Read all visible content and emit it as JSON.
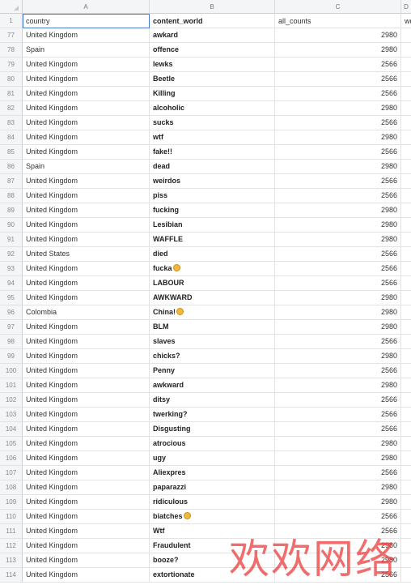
{
  "columns": [
    "A",
    "B",
    "C",
    "D"
  ],
  "header_row": {
    "num": "1",
    "country": "country",
    "content_world": "content_world",
    "all_counts": "all_counts",
    "d": "wo"
  },
  "rows": [
    {
      "num": "77",
      "country": "United Kingdom",
      "word": "awkard",
      "count": "2980"
    },
    {
      "num": "78",
      "country": "Spain",
      "word": "offence",
      "count": "2980"
    },
    {
      "num": "79",
      "country": "United Kingdom",
      "word": "lewks",
      "count": "2566"
    },
    {
      "num": "80",
      "country": "United Kingdom",
      "word": "Beetle",
      "count": "2566"
    },
    {
      "num": "81",
      "country": "United Kingdom",
      "word": "Killing",
      "count": "2566"
    },
    {
      "num": "82",
      "country": "United Kingdom",
      "word": "alcoholic",
      "count": "2980"
    },
    {
      "num": "83",
      "country": "United Kingdom",
      "word": "sucks",
      "count": "2566"
    },
    {
      "num": "84",
      "country": "United Kingdom",
      "word": "wtf",
      "count": "2980"
    },
    {
      "num": "85",
      "country": "United Kingdom",
      "word": "fake!!",
      "count": "2566"
    },
    {
      "num": "86",
      "country": "Spain",
      "word": "dead",
      "count": "2980"
    },
    {
      "num": "87",
      "country": "United Kingdom",
      "word": "weirdos",
      "count": "2566"
    },
    {
      "num": "88",
      "country": "United Kingdom",
      "word": "piss",
      "count": "2566"
    },
    {
      "num": "89",
      "country": "United Kingdom",
      "word": "fucking",
      "count": "2980"
    },
    {
      "num": "90",
      "country": "United Kingdom",
      "word": "Lesibian",
      "count": "2980"
    },
    {
      "num": "91",
      "country": "United Kingdom",
      "word": "WAFFLE",
      "count": "2980"
    },
    {
      "num": "92",
      "country": "United States",
      "word": "died",
      "count": "2566"
    },
    {
      "num": "93",
      "country": "United Kingdom",
      "word": "fucka",
      "count": "2566",
      "emoji": "rofl-emoji"
    },
    {
      "num": "94",
      "country": "United Kingdom",
      "word": "LABOUR",
      "count": "2566"
    },
    {
      "num": "95",
      "country": "United Kingdom",
      "word": "AWKWARD",
      "count": "2980"
    },
    {
      "num": "96",
      "country": "Colombia",
      "word": "China!",
      "count": "2980",
      "emoji": "grin-emoji"
    },
    {
      "num": "97",
      "country": "United Kingdom",
      "word": "BLM",
      "count": "2980"
    },
    {
      "num": "98",
      "country": "United Kingdom",
      "word": "slaves",
      "count": "2566"
    },
    {
      "num": "99",
      "country": "United Kingdom",
      "word": "chicks?",
      "count": "2980"
    },
    {
      "num": "100",
      "country": "United Kingdom",
      "word": "Penny",
      "count": "2566"
    },
    {
      "num": "101",
      "country": "United Kingdom",
      "word": "awkward",
      "count": "2980"
    },
    {
      "num": "102",
      "country": "United Kingdom",
      "word": "ditsy",
      "count": "2566"
    },
    {
      "num": "103",
      "country": "United Kingdom",
      "word": "twerking?",
      "count": "2566"
    },
    {
      "num": "104",
      "country": "United Kingdom",
      "word": "Disgusting",
      "count": "2566"
    },
    {
      "num": "105",
      "country": "United Kingdom",
      "word": "atrocious",
      "count": "2980"
    },
    {
      "num": "106",
      "country": "United Kingdom",
      "word": "ugy",
      "count": "2980"
    },
    {
      "num": "107",
      "country": "United Kingdom",
      "word": "Aliexpres",
      "count": "2566"
    },
    {
      "num": "108",
      "country": "United Kingdom",
      "word": "paparazzi",
      "count": "2980"
    },
    {
      "num": "109",
      "country": "United Kingdom",
      "word": "ridiculous",
      "count": "2980"
    },
    {
      "num": "110",
      "country": "United Kingdom",
      "word": "biatches",
      "count": "2566",
      "emoji": "grin-emoji"
    },
    {
      "num": "111",
      "country": "United Kingdom",
      "word": "Wtf",
      "count": "2566"
    },
    {
      "num": "112",
      "country": "United Kingdom",
      "word": "Fraudulent",
      "count": "2980"
    },
    {
      "num": "113",
      "country": "United Kingdom",
      "word": "booze?",
      "count": "2980"
    },
    {
      "num": "114",
      "country": "United Kingdom",
      "word": "extortionate",
      "count": "2566"
    }
  ],
  "watermark": "欢欢网络"
}
